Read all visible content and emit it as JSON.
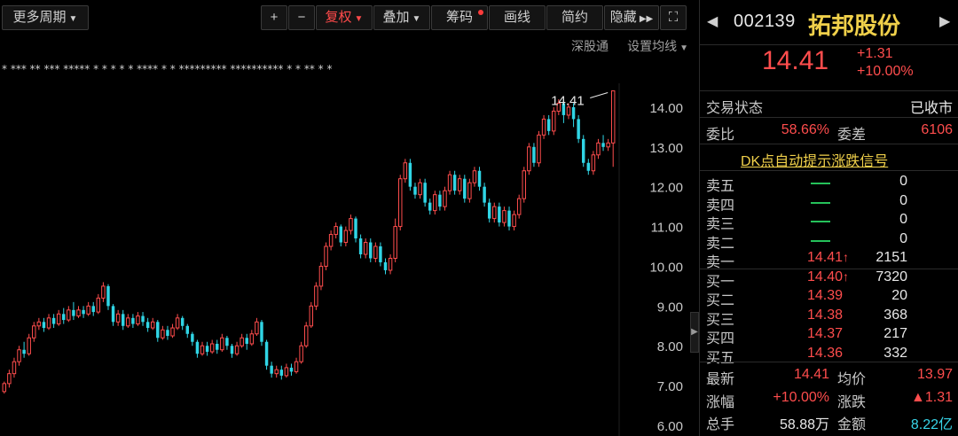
{
  "toolbar": {
    "more_period": "更多周期",
    "zoom_in": "+",
    "zoom_out": "−",
    "adjust": "复权",
    "overlay": "叠加",
    "chips": "筹码",
    "draw": "画线",
    "simple": "简约",
    "hide": "隐藏",
    "expand_icon": "⛶"
  },
  "subbar": {
    "exchange": "深股通",
    "ma_settings": "设置均线"
  },
  "chart_data": {
    "type": "candlestick",
    "y_axis_ticks": [
      "14.00",
      "13.00",
      "12.00",
      "11.00",
      "10.00",
      "9.00",
      "8.00",
      "7.00",
      "6.00"
    ],
    "ylim": [
      6.0,
      14.6
    ],
    "last_price_label": "14.41",
    "candles": [
      [
        6.85,
        7.05,
        6.8,
        7.1
      ],
      [
        7.05,
        7.3,
        6.95,
        7.4
      ],
      [
        7.3,
        7.6,
        7.2,
        7.7
      ],
      [
        7.6,
        7.9,
        7.5,
        8.0
      ],
      [
        7.9,
        7.8,
        7.7,
        8.1
      ],
      [
        7.8,
        8.2,
        7.75,
        8.3
      ],
      [
        8.2,
        8.5,
        8.1,
        8.6
      ],
      [
        8.5,
        8.6,
        8.4,
        8.7
      ],
      [
        8.6,
        8.45,
        8.35,
        8.7
      ],
      [
        8.45,
        8.7,
        8.4,
        8.8
      ],
      [
        8.7,
        8.55,
        8.45,
        8.8
      ],
      [
        8.55,
        8.8,
        8.5,
        8.9
      ],
      [
        8.8,
        8.65,
        8.55,
        8.95
      ],
      [
        8.65,
        8.9,
        8.6,
        9.0
      ],
      [
        8.9,
        8.75,
        8.65,
        9.1
      ],
      [
        8.75,
        8.9,
        8.7,
        9.0
      ],
      [
        8.9,
        8.8,
        8.7,
        9.0
      ],
      [
        8.8,
        9.0,
        8.75,
        9.1
      ],
      [
        9.0,
        8.85,
        8.75,
        9.1
      ],
      [
        8.85,
        9.2,
        8.8,
        9.3
      ],
      [
        9.2,
        9.5,
        9.1,
        9.6
      ],
      [
        9.5,
        9.0,
        8.9,
        9.55
      ],
      [
        9.0,
        8.6,
        8.5,
        9.05
      ],
      [
        8.6,
        8.8,
        8.5,
        8.9
      ],
      [
        8.8,
        8.5,
        8.4,
        8.9
      ],
      [
        8.5,
        8.7,
        8.45,
        8.8
      ],
      [
        8.7,
        8.55,
        8.45,
        8.8
      ],
      [
        8.55,
        8.75,
        8.5,
        8.85
      ],
      [
        8.75,
        8.6,
        8.5,
        8.85
      ],
      [
        8.6,
        8.45,
        8.35,
        8.7
      ],
      [
        8.45,
        8.6,
        8.4,
        8.7
      ],
      [
        8.6,
        8.2,
        8.1,
        8.65
      ],
      [
        8.2,
        8.4,
        8.15,
        8.5
      ],
      [
        8.4,
        8.25,
        8.15,
        8.5
      ],
      [
        8.25,
        8.45,
        8.2,
        8.55
      ],
      [
        8.45,
        8.7,
        8.4,
        8.8
      ],
      [
        8.7,
        8.5,
        8.4,
        8.75
      ],
      [
        8.5,
        8.3,
        8.2,
        8.55
      ],
      [
        8.3,
        8.1,
        8.0,
        8.35
      ],
      [
        8.1,
        7.8,
        7.7,
        8.15
      ],
      [
        7.8,
        8.0,
        7.75,
        8.1
      ],
      [
        8.0,
        7.85,
        7.75,
        8.1
      ],
      [
        7.85,
        8.05,
        7.8,
        8.15
      ],
      [
        8.05,
        7.9,
        7.8,
        8.15
      ],
      [
        7.9,
        8.2,
        7.85,
        8.3
      ],
      [
        8.2,
        8.0,
        7.9,
        8.25
      ],
      [
        8.0,
        7.8,
        7.7,
        8.05
      ],
      [
        7.8,
        8.0,
        7.75,
        8.1
      ],
      [
        8.0,
        8.2,
        7.95,
        8.3
      ],
      [
        8.2,
        8.05,
        7.9,
        8.3
      ],
      [
        8.05,
        8.3,
        8.0,
        8.4
      ],
      [
        8.3,
        8.6,
        8.25,
        8.7
      ],
      [
        8.6,
        8.1,
        8.0,
        8.65
      ],
      [
        8.1,
        7.5,
        7.4,
        8.15
      ],
      [
        7.5,
        7.3,
        7.2,
        7.6
      ],
      [
        7.3,
        7.4,
        7.2,
        7.5
      ],
      [
        7.4,
        7.25,
        7.15,
        7.5
      ],
      [
        7.25,
        7.45,
        7.2,
        7.55
      ],
      [
        7.45,
        7.35,
        7.25,
        7.55
      ],
      [
        7.35,
        7.6,
        7.3,
        7.7
      ],
      [
        7.6,
        8.0,
        7.55,
        8.1
      ],
      [
        8.0,
        8.5,
        7.95,
        8.6
      ],
      [
        8.5,
        9.0,
        8.45,
        9.1
      ],
      [
        9.0,
        9.5,
        8.9,
        9.6
      ],
      [
        9.5,
        10.0,
        9.4,
        10.1
      ],
      [
        10.0,
        10.5,
        9.9,
        10.6
      ],
      [
        10.5,
        10.8,
        10.4,
        10.9
      ],
      [
        10.8,
        11.0,
        10.7,
        11.1
      ],
      [
        11.0,
        10.6,
        10.5,
        11.05
      ],
      [
        10.6,
        10.9,
        10.5,
        11.0
      ],
      [
        10.9,
        11.2,
        10.8,
        11.3
      ],
      [
        11.2,
        10.7,
        10.6,
        11.25
      ],
      [
        10.7,
        10.3,
        10.2,
        10.8
      ],
      [
        10.3,
        10.6,
        10.2,
        10.7
      ],
      [
        10.6,
        10.2,
        10.1,
        10.7
      ],
      [
        10.2,
        10.5,
        10.1,
        10.6
      ],
      [
        10.5,
        10.1,
        10.0,
        10.6
      ],
      [
        10.1,
        9.9,
        9.8,
        10.2
      ],
      [
        9.9,
        10.2,
        9.8,
        10.3
      ],
      [
        10.2,
        11.0,
        10.1,
        11.2
      ],
      [
        11.0,
        12.2,
        10.9,
        12.3
      ],
      [
        12.2,
        12.6,
        12.1,
        12.7
      ],
      [
        12.6,
        12.0,
        11.9,
        12.7
      ],
      [
        12.0,
        11.8,
        11.7,
        12.1
      ],
      [
        11.8,
        12.1,
        11.7,
        12.2
      ],
      [
        12.1,
        11.6,
        11.5,
        12.2
      ],
      [
        11.6,
        11.4,
        11.3,
        11.7
      ],
      [
        11.4,
        11.8,
        11.3,
        11.9
      ],
      [
        11.8,
        11.5,
        11.4,
        11.9
      ],
      [
        11.5,
        11.9,
        11.4,
        12.0
      ],
      [
        11.9,
        12.3,
        11.8,
        12.4
      ],
      [
        12.3,
        11.9,
        11.8,
        12.4
      ],
      [
        11.9,
        12.2,
        11.8,
        12.3
      ],
      [
        12.2,
        11.7,
        11.6,
        12.3
      ],
      [
        11.7,
        12.1,
        11.6,
        12.2
      ],
      [
        12.1,
        12.4,
        12.0,
        12.5
      ],
      [
        12.4,
        12.0,
        11.9,
        12.5
      ],
      [
        12.0,
        11.6,
        11.5,
        12.1
      ],
      [
        11.6,
        11.2,
        11.1,
        11.7
      ],
      [
        11.2,
        11.5,
        11.1,
        11.6
      ],
      [
        11.5,
        11.1,
        11.0,
        11.6
      ],
      [
        11.1,
        11.4,
        11.0,
        11.5
      ],
      [
        11.4,
        11.0,
        10.9,
        11.5
      ],
      [
        11.0,
        11.3,
        10.9,
        11.4
      ],
      [
        11.3,
        11.7,
        11.2,
        11.8
      ],
      [
        11.7,
        12.4,
        11.6,
        12.5
      ],
      [
        12.4,
        13.0,
        12.3,
        13.1
      ],
      [
        13.0,
        12.6,
        12.5,
        13.1
      ],
      [
        12.6,
        13.3,
        12.5,
        13.4
      ],
      [
        13.3,
        13.7,
        13.2,
        13.8
      ],
      [
        13.7,
        13.4,
        13.3,
        13.8
      ],
      [
        13.4,
        13.9,
        13.3,
        14.0
      ],
      [
        13.9,
        14.1,
        13.8,
        14.2
      ],
      [
        14.1,
        13.8,
        13.6,
        14.2
      ],
      [
        13.8,
        14.0,
        13.7,
        14.1
      ],
      [
        14.0,
        13.7,
        13.5,
        14.1
      ],
      [
        13.7,
        13.2,
        13.1,
        13.8
      ],
      [
        13.2,
        12.6,
        12.5,
        13.3
      ],
      [
        12.6,
        12.4,
        12.3,
        12.7
      ],
      [
        12.4,
        12.8,
        12.3,
        12.9
      ],
      [
        12.8,
        13.1,
        12.7,
        13.2
      ],
      [
        13.1,
        13.0,
        12.9,
        13.3
      ],
      [
        13.0,
        13.1,
        12.9,
        13.2
      ],
      [
        13.1,
        14.41,
        12.5,
        14.41
      ]
    ]
  },
  "quote": {
    "code": "002139",
    "name": "拓邦股份",
    "price": "14.41",
    "change": "+1.31",
    "change_pct": "+10.00%",
    "trade_status_label": "交易状态",
    "trade_status": "已收市",
    "wb_label": "委比",
    "wb_value": "58.66%",
    "wc_label": "委差",
    "wc_value": "6106",
    "dk_signal": "DK点自动提示涨跌信号",
    "asks": [
      {
        "label": "卖五",
        "price": "",
        "vol": "0"
      },
      {
        "label": "卖四",
        "price": "",
        "vol": "0"
      },
      {
        "label": "卖三",
        "price": "",
        "vol": "0"
      },
      {
        "label": "卖二",
        "price": "",
        "vol": "0"
      },
      {
        "label": "卖一",
        "price": "14.41",
        "vol": "2151"
      }
    ],
    "bids": [
      {
        "label": "买一",
        "price": "14.40",
        "vol": "7320"
      },
      {
        "label": "买二",
        "price": "14.39",
        "vol": "20"
      },
      {
        "label": "买三",
        "price": "14.38",
        "vol": "368"
      },
      {
        "label": "买四",
        "price": "14.37",
        "vol": "217"
      },
      {
        "label": "买五",
        "price": "14.36",
        "vol": "332"
      }
    ],
    "latest_label": "最新",
    "latest_value": "14.41",
    "avg_label": "均价",
    "avg_value": "13.97",
    "pct_label": "涨幅",
    "pct_value": "+10.00%",
    "chg_label": "涨跌",
    "chg_value": "▲1.31",
    "vol_label": "总手",
    "vol_value": "58.88万",
    "amt_label": "金额",
    "amt_value": "8.22亿"
  },
  "colors": {
    "up": "#ff4d4d",
    "down": "#30d5e5",
    "name": "#f0d04a"
  }
}
